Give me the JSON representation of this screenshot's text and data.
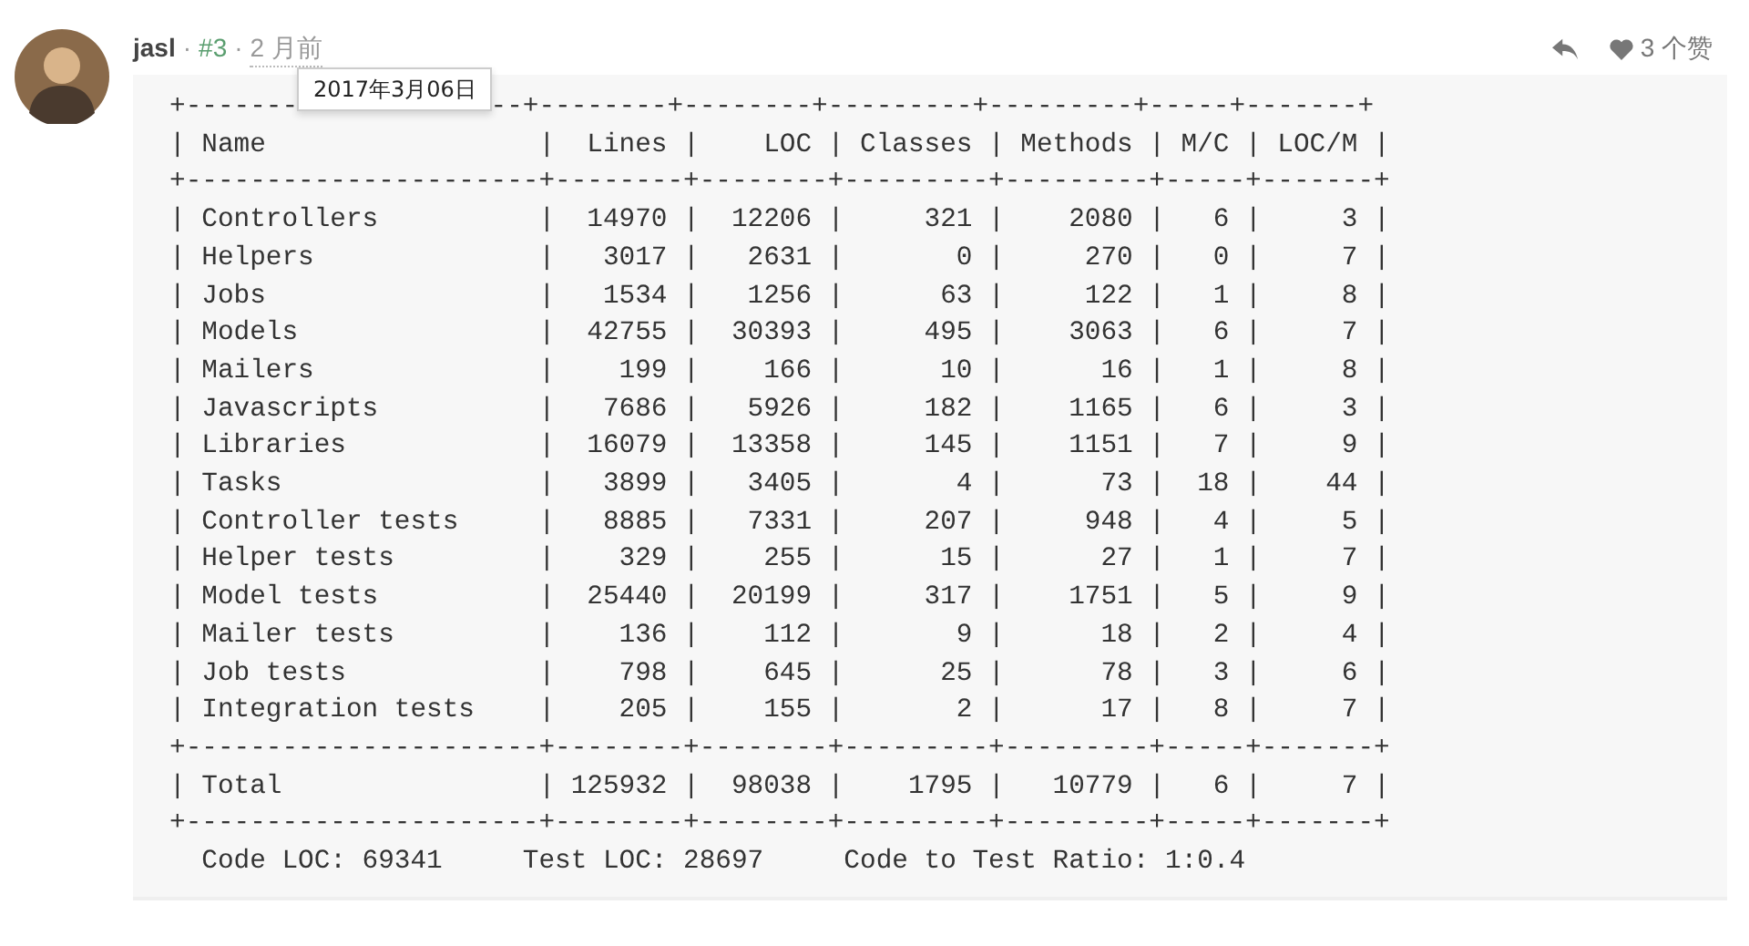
{
  "comment": {
    "author": "jasl",
    "separator_1": "·",
    "floor": "#3",
    "separator_2": "·",
    "time": "2 月前",
    "tooltip": "2017年3月06日",
    "likes": "3 个赞",
    "code": {
      "first_line_left": "+-------",
      "first_line_right": "--+--------+--------+---------+---------+-----+-------+",
      "lines": [
        "| Name                 |  Lines |    LOC | Classes | Methods | M/C | LOC/M |",
        "+----------------------+--------+--------+---------+---------+-----+-------+",
        "| Controllers          |  14970 |  12206 |     321 |    2080 |   6 |     3 |",
        "| Helpers              |   3017 |   2631 |       0 |     270 |   0 |     7 |",
        "| Jobs                 |   1534 |   1256 |      63 |     122 |   1 |     8 |",
        "| Models               |  42755 |  30393 |     495 |    3063 |   6 |     7 |",
        "| Mailers              |    199 |    166 |      10 |      16 |   1 |     8 |",
        "| Javascripts          |   7686 |   5926 |     182 |    1165 |   6 |     3 |",
        "| Libraries            |  16079 |  13358 |     145 |    1151 |   7 |     9 |",
        "| Tasks                |   3899 |   3405 |       4 |      73 |  18 |    44 |",
        "| Controller tests     |   8885 |   7331 |     207 |     948 |   4 |     5 |",
        "| Helper tests         |    329 |    255 |      15 |      27 |   1 |     7 |",
        "| Model tests          |  25440 |  20199 |     317 |    1751 |   5 |     9 |",
        "| Mailer tests         |    136 |    112 |       9 |      18 |   2 |     4 |",
        "| Job tests            |    798 |    645 |      25 |      78 |   3 |     6 |",
        "| Integration tests    |    205 |    155 |       2 |      17 |   8 |     7 |",
        "+----------------------+--------+--------+---------+---------+-----+-------+",
        "| Total                | 125932 |  98038 |    1795 |   10779 |   6 |     7 |",
        "+----------------------+--------+--------+---------+---------+-----+-------+",
        "  Code LOC: 69341     Test LOC: 28697     Code to Test Ratio: 1:0.4"
      ]
    }
  }
}
